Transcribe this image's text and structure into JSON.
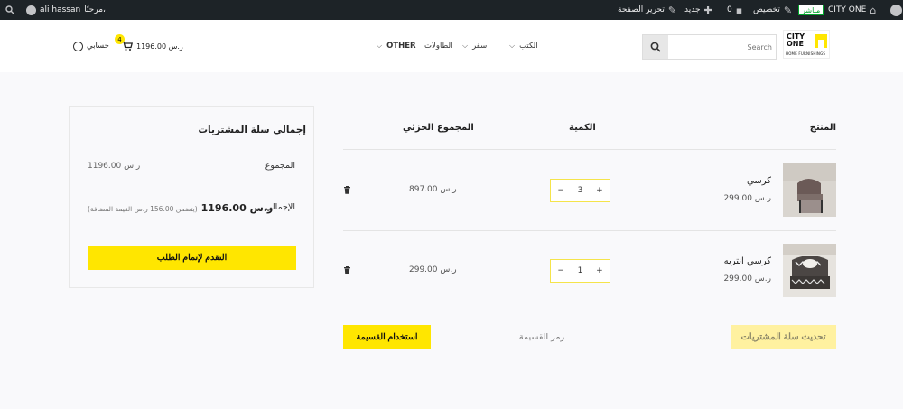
{
  "admin_bar": {
    "site_name": "CITY ONE",
    "live_badge": "مباشر",
    "customize": "تخصيص",
    "comments_count": "0",
    "new_label": "جديد",
    "edit_page": "تحرير الصفحة",
    "greeting": "مرحبًا،",
    "user_name": "ali hassan"
  },
  "header": {
    "logo_line1": "CITY",
    "logo_line2": "ONE",
    "logo_sub": "HOME FURNISHINGS",
    "search_placeholder": "Search",
    "nav": [
      "الكتب",
      "سفر",
      "الطاولات",
      "OTHER"
    ],
    "cart_total": "1196.00 ر.س",
    "cart_count": "4",
    "account_label": "حسابي"
  },
  "cart": {
    "columns": {
      "product": "المنتج",
      "quantity": "الكمية",
      "subtotal": "المجموع الجزئي"
    },
    "items": [
      {
        "name": "كرسي",
        "price": "299.00 ر.س",
        "quantity": "3",
        "subtotal": "897.00 ر.س"
      },
      {
        "name": "كرسي انتريه",
        "price": "299.00 ر.س",
        "quantity": "1",
        "subtotal": "299.00 ر.س"
      }
    ],
    "qty_minus": "−",
    "qty_plus": "+",
    "update_button": "تحديث سلة المشتريات",
    "coupon_placeholder": "رمز القسيمة",
    "apply_coupon_button": "استخدام القسيمة"
  },
  "totals": {
    "title": "إجمالي سلة المشتريات",
    "subtotal_label": "المجموع",
    "subtotal_value": "1196.00 ر.س",
    "total_label": "الإجمالي",
    "total_value": "1196.00 ر.س",
    "tax_note": "(يتضمن 156.00 ر.س القيمة المضافة)",
    "checkout_button": "التقدم لإتمام الطلب"
  },
  "colors": {
    "accent": "#ffe600",
    "admin_bar": "#1d2327"
  }
}
